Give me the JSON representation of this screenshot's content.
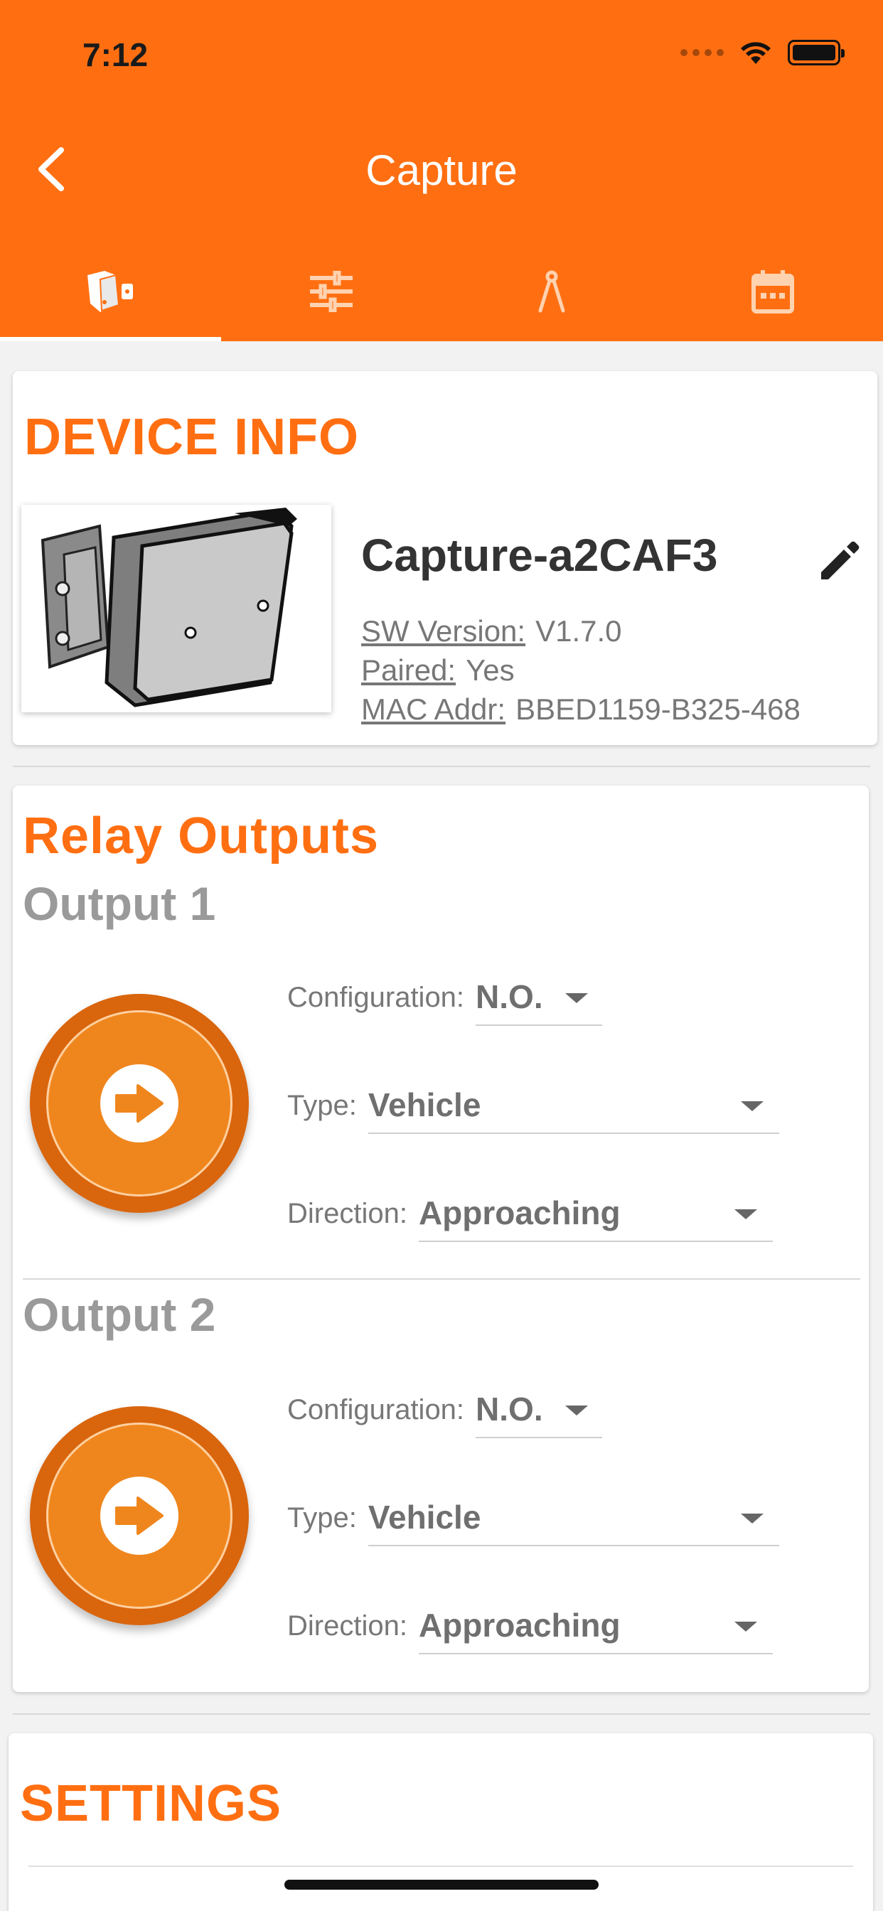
{
  "status_bar": {
    "time": "7:12"
  },
  "header": {
    "title": "Capture",
    "back_icon": "chevron-left-icon"
  },
  "tabs": [
    {
      "icon": "device-icon",
      "active": true
    },
    {
      "icon": "sliders-icon",
      "active": false
    },
    {
      "icon": "compass-icon",
      "active": false
    },
    {
      "icon": "calendar-icon",
      "active": false
    }
  ],
  "device_info": {
    "section_title": "DEVICE INFO",
    "device_name": "Capture-a2CAF3",
    "rows": [
      {
        "label": "SW Version:",
        "value": "V1.7.0"
      },
      {
        "label": "Paired:",
        "value": "Yes"
      },
      {
        "label": "MAC Addr:",
        "value": "BBED1159-B325-468"
      }
    ]
  },
  "relay_outputs": {
    "section_title": "Relay Outputs",
    "outputs": [
      {
        "title": "Output 1",
        "configuration": {
          "label": "Configuration:",
          "value": "N.O."
        },
        "type": {
          "label": "Type:",
          "value": "Vehicle"
        },
        "direction": {
          "label": "Direction:",
          "value": "Approaching"
        }
      },
      {
        "title": "Output 2",
        "configuration": {
          "label": "Configuration:",
          "value": "N.O."
        },
        "type": {
          "label": "Type:",
          "value": "Vehicle"
        },
        "direction": {
          "label": "Direction:",
          "value": "Approaching"
        }
      }
    ]
  },
  "settings": {
    "section_title": "SETTINGS"
  },
  "colors": {
    "brand": "#ff6f12",
    "relay_button": "#ef861d"
  }
}
